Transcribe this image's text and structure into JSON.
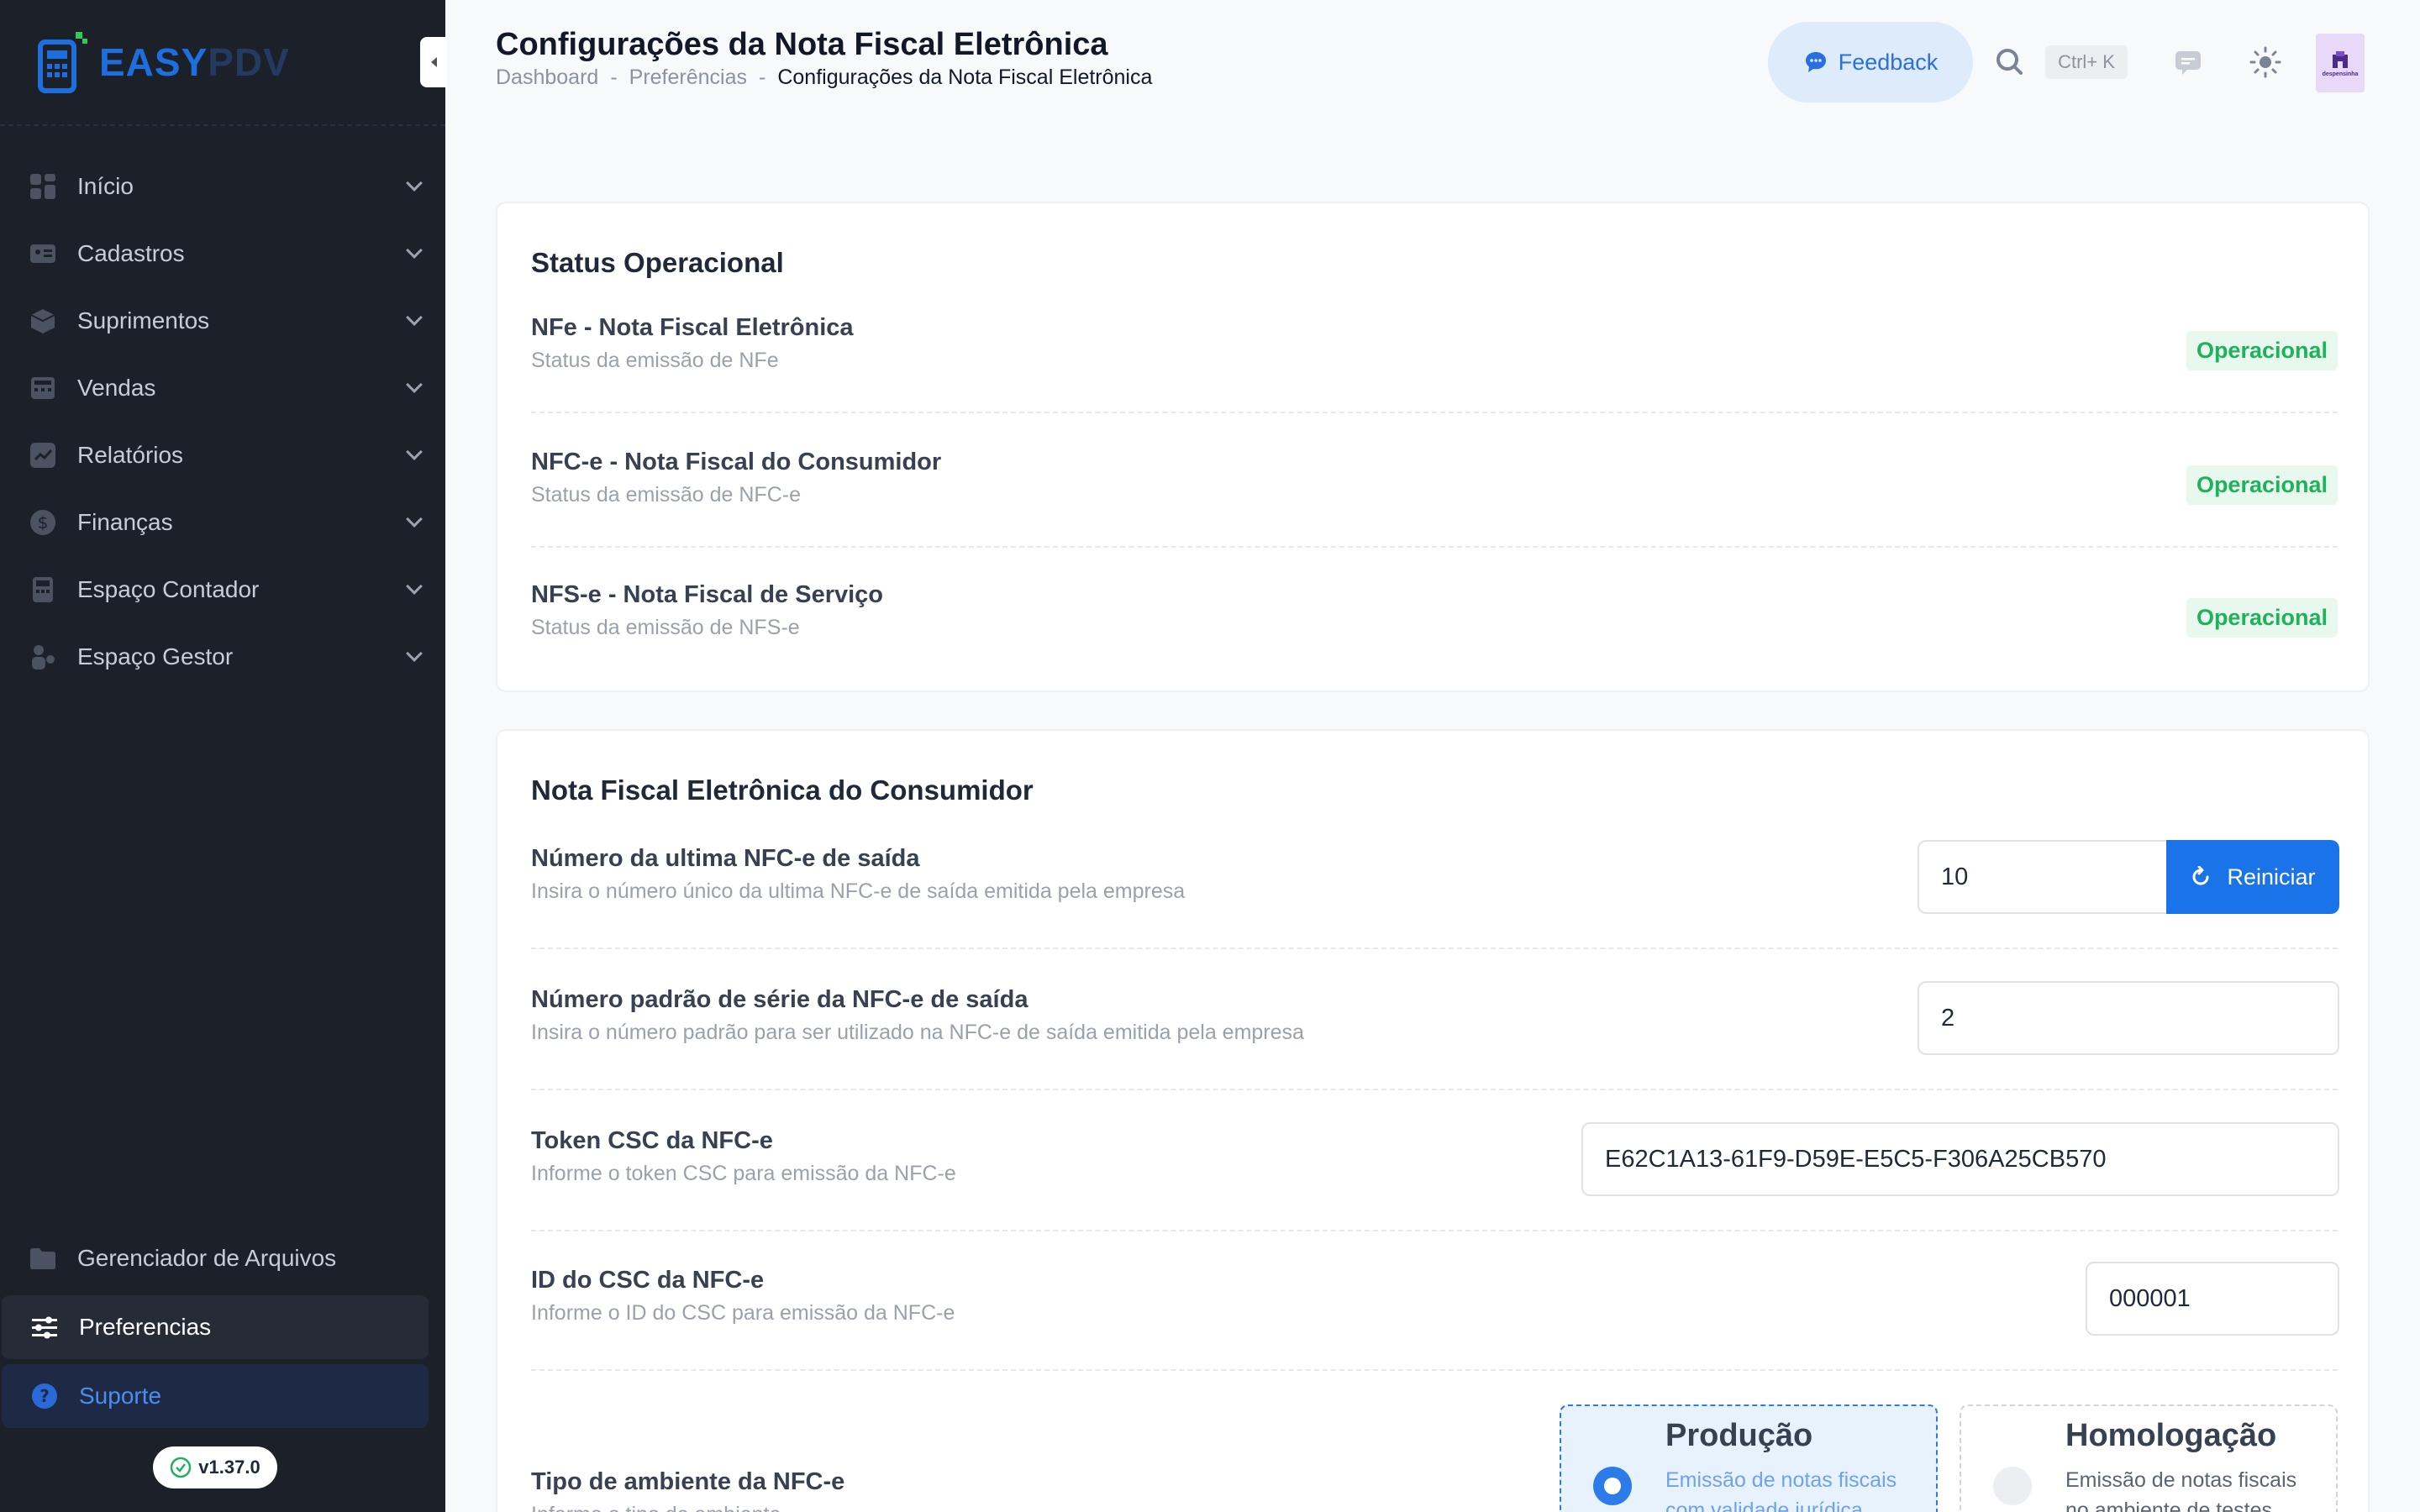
{
  "sidebar": {
    "brand_easy": "EASY",
    "brand_pdv": "PDV",
    "items": [
      {
        "label": "Início",
        "icon": "grid-icon"
      },
      {
        "label": "Cadastros",
        "icon": "id-card-icon"
      },
      {
        "label": "Suprimentos",
        "icon": "box-icon"
      },
      {
        "label": "Vendas",
        "icon": "register-icon"
      },
      {
        "label": "Relatórios",
        "icon": "chart-icon"
      },
      {
        "label": "Finanças",
        "icon": "dollar-icon"
      },
      {
        "label": "Espaço Contador",
        "icon": "calculator-icon"
      },
      {
        "label": "Espaço Gestor",
        "icon": "manager-icon"
      }
    ],
    "bottom": {
      "files": "Gerenciador de Arquivos",
      "prefs": "Preferencias",
      "support": "Suporte"
    },
    "version": "v1.37.0"
  },
  "header": {
    "title": "Configurações da Nota Fiscal Eletrônica",
    "breadcrumb": [
      "Dashboard",
      "Preferências",
      "Configurações da Nota Fiscal Eletrônica"
    ],
    "breadcrumb_sep": "-",
    "feedback": "Feedback",
    "shortcut": "Ctrl+ K",
    "avatar_text": "despensinha"
  },
  "status_card": {
    "title": "Status Operacional",
    "rows": [
      {
        "title": "NFe - Nota Fiscal Eletrônica",
        "sub": "Status da emissão de NFe",
        "status": "Operacional"
      },
      {
        "title": "NFC-e - Nota Fiscal do Consumidor",
        "sub": "Status da emissão de NFC-e",
        "status": "Operacional"
      },
      {
        "title": "NFS-e - Nota Fiscal de Serviço",
        "sub": "Status da emissão de NFS-e",
        "status": "Operacional"
      }
    ]
  },
  "nfce_card": {
    "title": "Nota Fiscal Eletrônica do Consumidor",
    "last_number": {
      "title": "Número da ultima NFC-e de saída",
      "sub": "Insira o número único da ultima NFC-e de saída emitida pela empresa",
      "value": "10",
      "button": "Reiniciar"
    },
    "series": {
      "title": "Número padrão de série da NFC-e de saída",
      "sub": "Insira o número padrão para ser utilizado na NFC-e de saída emitida pela empresa",
      "value": "2"
    },
    "token": {
      "title": "Token CSC da NFC-e",
      "sub": "Informe o token CSC para emissão da NFC-e",
      "value": "E62C1A13-61F9-D59E-E5C5-F306A25CB570"
    },
    "csc_id": {
      "title": "ID do CSC da NFC-e",
      "sub": "Informe o ID do CSC para emissão da NFC-e",
      "value": "000001"
    },
    "environment": {
      "title": "Tipo de ambiente da NFC-e",
      "sub": "Informe o tipo de ambiente",
      "options": [
        {
          "title": "Produção",
          "desc": "Emissão de notas fiscais com validade jurídica",
          "selected": true
        },
        {
          "title": "Homologação",
          "desc": "Emissão de notas fiscais no ambiente de testes",
          "selected": false
        }
      ]
    }
  },
  "colors": {
    "accent": "#1a73e8",
    "sidebar": "#1c2029",
    "success": "#21b15b"
  }
}
